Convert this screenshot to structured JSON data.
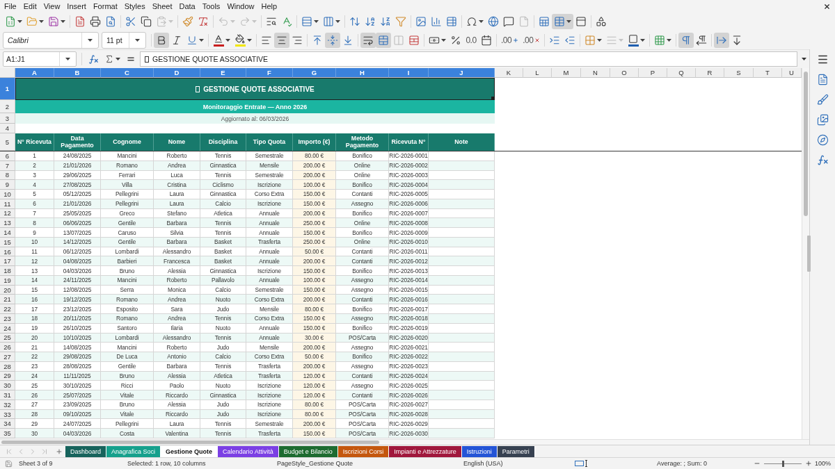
{
  "menu": [
    "File",
    "Edit",
    "View",
    "Insert",
    "Format",
    "Styles",
    "Sheet",
    "Data",
    "Tools",
    "Window",
    "Help"
  ],
  "standard_toolbar": {
    "groups": [
      [
        {
          "kind": "new",
          "on": false,
          "disabled": false
        },
        {
          "kind": "open",
          "on": false,
          "disabled": false
        },
        {
          "kind": "save",
          "on": false,
          "disabled": false
        }
      ],
      [
        {
          "kind": "pdf",
          "on": false,
          "disabled": false
        },
        {
          "kind": "print",
          "on": false,
          "disabled": false
        },
        {
          "kind": "preview",
          "on": false,
          "disabled": false
        }
      ],
      [
        {
          "kind": "cut",
          "on": false,
          "disabled": false
        },
        {
          "kind": "copy",
          "on": false,
          "disabled": false
        },
        {
          "kind": "paste",
          "on": false,
          "disabled": true
        }
      ],
      [
        {
          "kind": "clone",
          "on": false,
          "disabled": false
        },
        {
          "kind": "clear",
          "on": false,
          "disabled": false
        }
      ],
      [
        {
          "kind": "undo",
          "on": false,
          "disabled": true
        },
        {
          "kind": "redo",
          "on": false,
          "disabled": true
        }
      ],
      [
        {
          "kind": "find",
          "on": false,
          "disabled": false
        },
        {
          "kind": "spelling",
          "on": false,
          "disabled": false
        }
      ],
      [
        {
          "kind": "row",
          "on": false,
          "disabled": false
        },
        {
          "kind": "column",
          "on": false,
          "disabled": false
        }
      ],
      [
        {
          "kind": "sort",
          "on": false,
          "disabled": false
        },
        {
          "kind": "sortasc",
          "on": false,
          "disabled": false
        },
        {
          "kind": "sortdesc",
          "on": false,
          "disabled": false
        },
        {
          "kind": "autofilter",
          "on": false,
          "disabled": false
        }
      ],
      [
        {
          "kind": "image",
          "on": false,
          "disabled": false
        },
        {
          "kind": "chart",
          "on": false,
          "disabled": false
        },
        {
          "kind": "pivot",
          "on": false,
          "disabled": false
        }
      ],
      [
        {
          "kind": "special",
          "on": false,
          "disabled": false
        },
        {
          "kind": "hyperlink",
          "on": false,
          "disabled": false
        },
        {
          "kind": "comment",
          "on": false,
          "disabled": false
        },
        {
          "kind": "headerfooter",
          "on": false,
          "disabled": true
        }
      ],
      [
        {
          "kind": "printrange",
          "on": false,
          "disabled": false
        },
        {
          "kind": "freeze",
          "on": true,
          "disabled": false
        },
        {
          "kind": "split",
          "on": false,
          "disabled": false
        }
      ],
      [
        {
          "kind": "shapes",
          "on": false,
          "disabled": false
        }
      ]
    ]
  },
  "formatting_toolbar": {
    "font_name": "Calibri",
    "font_substituted": true,
    "font_size": "11 pt",
    "groups": [
      [
        {
          "kind": "bold",
          "on": true,
          "disabled": false
        },
        {
          "kind": "italic",
          "on": false,
          "disabled": false
        },
        {
          "kind": "underline",
          "on": false,
          "disabled": false
        }
      ],
      [
        {
          "kind": "fontcolor",
          "on": false,
          "disabled": false
        },
        {
          "kind": "highlight",
          "on": false,
          "disabled": false
        }
      ],
      [
        {
          "kind": "alignleft",
          "on": false,
          "disabled": false
        },
        {
          "kind": "aligncenter",
          "on": true,
          "disabled": false
        },
        {
          "kind": "alignright",
          "on": false,
          "disabled": false
        }
      ],
      [
        {
          "kind": "aligntop",
          "on": false,
          "disabled": false
        },
        {
          "kind": "alignmiddle",
          "on": true,
          "disabled": false
        },
        {
          "kind": "alignbottom",
          "on": false,
          "disabled": false
        }
      ],
      [
        {
          "kind": "wrap",
          "on": true,
          "disabled": false
        },
        {
          "kind": "mergecenter",
          "on": true,
          "disabled": false
        },
        {
          "kind": "merge",
          "on": false,
          "disabled": true
        },
        {
          "kind": "unmerge",
          "on": false,
          "disabled": false
        }
      ],
      [
        {
          "kind": "currency",
          "on": false,
          "disabled": false
        },
        {
          "kind": "percent",
          "on": false,
          "disabled": false
        },
        {
          "kind": "number",
          "label": "0.0",
          "on": false,
          "disabled": false
        },
        {
          "kind": "date",
          "on": false,
          "disabled": false
        }
      ],
      [
        {
          "kind": "adddec",
          "label": ".00",
          "on": false,
          "disabled": false
        },
        {
          "kind": "deldec",
          "label": ".00",
          "on": false,
          "disabled": false
        }
      ],
      [
        {
          "kind": "indentmore",
          "on": false,
          "disabled": false
        },
        {
          "kind": "indentless",
          "on": false,
          "disabled": false
        }
      ],
      [
        {
          "kind": "borders",
          "on": false,
          "disabled": false
        },
        {
          "kind": "borderstyle",
          "on": false,
          "disabled": true
        },
        {
          "kind": "bordercolor",
          "on": false,
          "disabled": false
        }
      ],
      [
        {
          "kind": "conditional",
          "on": false,
          "disabled": false
        }
      ],
      [
        {
          "kind": "ltr",
          "on": true,
          "disabled": false
        },
        {
          "kind": "rtl",
          "on": false,
          "disabled": false
        }
      ],
      [
        {
          "kind": "textdir",
          "on": true,
          "disabled": false
        },
        {
          "kind": "vertical",
          "on": false,
          "disabled": false
        }
      ]
    ]
  },
  "formula_bar": {
    "name_box": "A1:J1",
    "formula": "GESTIONE QUOTE ASSOCIATIVE"
  },
  "sheet": {
    "columns": [
      {
        "label": "A",
        "selected": true
      },
      {
        "label": "B",
        "selected": true
      },
      {
        "label": "C",
        "selected": true
      },
      {
        "label": "D",
        "selected": true
      },
      {
        "label": "E",
        "selected": true
      },
      {
        "label": "F",
        "selected": true
      },
      {
        "label": "G",
        "selected": true
      },
      {
        "label": "H",
        "selected": true
      },
      {
        "label": "I",
        "selected": true
      },
      {
        "label": "J",
        "selected": true
      },
      {
        "label": "K",
        "selected": false
      },
      {
        "label": "L",
        "selected": false
      },
      {
        "label": "M",
        "selected": false
      },
      {
        "label": "N",
        "selected": false
      },
      {
        "label": "O",
        "selected": false
      },
      {
        "label": "P",
        "selected": false
      },
      {
        "label": "Q",
        "selected": false
      },
      {
        "label": "R",
        "selected": false
      },
      {
        "label": "S",
        "selected": false
      },
      {
        "label": "T",
        "selected": false
      },
      {
        "label": "U",
        "selected": false
      }
    ],
    "rows": [
      {
        "label": "1",
        "selected": true
      },
      {
        "label": "2",
        "selected": false
      },
      {
        "label": "3",
        "selected": false
      },
      {
        "label": "4",
        "selected": false
      },
      {
        "label": "5",
        "selected": false
      },
      {
        "label": "6",
        "selected": false
      },
      {
        "label": "7",
        "selected": false
      },
      {
        "label": "8",
        "selected": false
      },
      {
        "label": "9",
        "selected": false
      },
      {
        "label": "10",
        "selected": false
      },
      {
        "label": "11",
        "selected": false
      },
      {
        "label": "12",
        "selected": false
      },
      {
        "label": "13",
        "selected": false
      },
      {
        "label": "14",
        "selected": false
      },
      {
        "label": "15",
        "selected": false
      },
      {
        "label": "16",
        "selected": false
      },
      {
        "label": "17",
        "selected": false
      },
      {
        "label": "18",
        "selected": false
      },
      {
        "label": "19",
        "selected": false
      },
      {
        "label": "20",
        "selected": false
      },
      {
        "label": "21",
        "selected": false
      },
      {
        "label": "22",
        "selected": false
      },
      {
        "label": "23",
        "selected": false
      },
      {
        "label": "24",
        "selected": false
      },
      {
        "label": "25",
        "selected": false
      },
      {
        "label": "26",
        "selected": false
      },
      {
        "label": "27",
        "selected": false
      },
      {
        "label": "28",
        "selected": false
      },
      {
        "label": "29",
        "selected": false
      },
      {
        "label": "30",
        "selected": false
      },
      {
        "label": "31",
        "selected": false
      },
      {
        "label": "32",
        "selected": false
      },
      {
        "label": "33",
        "selected": false
      },
      {
        "label": "34",
        "selected": false
      },
      {
        "label": "35",
        "selected": false
      }
    ],
    "title": {
      "text": "GESTIONE QUOTE ASSOCIATIVE",
      "selected": true
    },
    "subtitle": "Monitoraggio Entrate — Anno 2026",
    "updated": "Aggiornato al: 06/03/2026",
    "headers": [
      "N° Ricevuta",
      "Data Pagamento",
      "Cognome",
      "Nome",
      "Disciplina",
      "Tipo Quota",
      "Importo (€)",
      "Metodo Pagamento",
      "Ricevuta N°",
      "Note"
    ],
    "records": [
      [
        "1",
        "24/08/2025",
        "Mancini",
        "Roberto",
        "Tennis",
        "Semestrale",
        "80.00 €",
        "Bonifico",
        "RIC-2026-0001"
      ],
      [
        "2",
        "21/01/2026",
        "Romano",
        "Andrea",
        "Ginnastica",
        "Mensile",
        "200.00 €",
        "Online",
        "RIC-2026-0002"
      ],
      [
        "3",
        "29/06/2025",
        "Ferrari",
        "Luca",
        "Tennis",
        "Semestrale",
        "200.00 €",
        "Online",
        "RIC-2026-0003"
      ],
      [
        "4",
        "27/08/2025",
        "Villa",
        "Cristina",
        "Ciclismo",
        "Iscrizione",
        "100.00 €",
        "Bonifico",
        "RIC-2026-0004"
      ],
      [
        "5",
        "05/12/2025",
        "Pellegrini",
        "Laura",
        "Ginnastica",
        "Corso Extra",
        "150.00 €",
        "Contanti",
        "RIC-2026-0005"
      ],
      [
        "6",
        "21/01/2026",
        "Pellegrini",
        "Laura",
        "Calcio",
        "Iscrizione",
        "150.00 €",
        "Assegno",
        "RIC-2026-0006"
      ],
      [
        "7",
        "25/05/2025",
        "Greco",
        "Stefano",
        "Atletica",
        "Annuale",
        "200.00 €",
        "Bonifico",
        "RIC-2026-0007"
      ],
      [
        "8",
        "06/06/2025",
        "Gentile",
        "Barbara",
        "Tennis",
        "Annuale",
        "250.00 €",
        "Online",
        "RIC-2026-0008"
      ],
      [
        "9",
        "13/07/2025",
        "Caruso",
        "Silvia",
        "Tennis",
        "Annuale",
        "150.00 €",
        "Bonifico",
        "RIC-2026-0009"
      ],
      [
        "10",
        "14/12/2025",
        "Gentile",
        "Barbara",
        "Basket",
        "Trasferta",
        "250.00 €",
        "Online",
        "RIC-2026-0010"
      ],
      [
        "11",
        "06/12/2025",
        "Lombardi",
        "Alessandro",
        "Basket",
        "Annuale",
        "50.00 €",
        "Contanti",
        "RIC-2026-0011"
      ],
      [
        "12",
        "04/08/2025",
        "Barbieri",
        "Francesca",
        "Basket",
        "Annuale",
        "200.00 €",
        "Contanti",
        "RIC-2026-0012"
      ],
      [
        "13",
        "04/03/2026",
        "Bruno",
        "Alessia",
        "Ginnastica",
        "Iscrizione",
        "150.00 €",
        "Bonifico",
        "RIC-2026-0013"
      ],
      [
        "14",
        "24/11/2025",
        "Mancini",
        "Roberto",
        "Pallavolo",
        "Annuale",
        "100.00 €",
        "Assegno",
        "RIC-2026-0014"
      ],
      [
        "15",
        "12/08/2025",
        "Serra",
        "Monica",
        "Calcio",
        "Semestrale",
        "150.00 €",
        "Assegno",
        "RIC-2026-0015"
      ],
      [
        "16",
        "19/12/2025",
        "Romano",
        "Andrea",
        "Nuoto",
        "Corso Extra",
        "200.00 €",
        "Contanti",
        "RIC-2026-0016"
      ],
      [
        "17",
        "23/12/2025",
        "Esposito",
        "Sara",
        "Judo",
        "Mensile",
        "80.00 €",
        "Bonifico",
        "RIC-2026-0017"
      ],
      [
        "18",
        "20/11/2025",
        "Romano",
        "Andrea",
        "Tennis",
        "Corso Extra",
        "150.00 €",
        "Assegno",
        "RIC-2026-0018"
      ],
      [
        "19",
        "26/10/2025",
        "Santoro",
        "Ilaria",
        "Nuoto",
        "Annuale",
        "150.00 €",
        "Bonifico",
        "RIC-2026-0019"
      ],
      [
        "20",
        "10/10/2025",
        "Lombardi",
        "Alessandro",
        "Tennis",
        "Annuale",
        "30.00 €",
        "POS/Carta",
        "RIC-2026-0020"
      ],
      [
        "21",
        "14/08/2025",
        "Mancini",
        "Roberto",
        "Judo",
        "Mensile",
        "200.00 €",
        "Assegno",
        "RIC-2026-0021"
      ],
      [
        "22",
        "29/08/2025",
        "De Luca",
        "Antonio",
        "Calcio",
        "Corso Extra",
        "50.00 €",
        "Bonifico",
        "RIC-2026-0022"
      ],
      [
        "23",
        "28/08/2025",
        "Gentile",
        "Barbara",
        "Tennis",
        "Trasferta",
        "200.00 €",
        "Assegno",
        "RIC-2026-0023"
      ],
      [
        "24",
        "11/11/2025",
        "Bruno",
        "Alessia",
        "Atletica",
        "Trasferta",
        "120.00 €",
        "Contanti",
        "RIC-2026-0024"
      ],
      [
        "25",
        "30/10/2025",
        "Ricci",
        "Paolo",
        "Nuoto",
        "Iscrizione",
        "120.00 €",
        "Assegno",
        "RIC-2026-0025"
      ],
      [
        "26",
        "25/07/2025",
        "Vitale",
        "Riccardo",
        "Ginnastica",
        "Iscrizione",
        "120.00 €",
        "Contanti",
        "RIC-2026-0026"
      ],
      [
        "27",
        "23/09/2025",
        "Bruno",
        "Alessia",
        "Judo",
        "Iscrizione",
        "80.00 €",
        "POS/Carta",
        "RIC-2026-0027"
      ],
      [
        "28",
        "09/10/2025",
        "Vitale",
        "Riccardo",
        "Judo",
        "Iscrizione",
        "80.00 €",
        "POS/Carta",
        "RIC-2026-0028"
      ],
      [
        "29",
        "24/07/2025",
        "Pellegrini",
        "Laura",
        "Tennis",
        "Semestrale",
        "200.00 €",
        "POS/Carta",
        "RIC-2026-0029"
      ],
      [
        "30",
        "04/03/2026",
        "Costa",
        "Valentina",
        "Tennis",
        "Trasferta",
        "150.00 €",
        "POS/Carta",
        "RIC-2026-0030"
      ]
    ]
  },
  "sheet_tabs": [
    {
      "label": "Dashboard",
      "selected": false,
      "color": "#17635c"
    },
    {
      "label": "Anagrafica Soci",
      "selected": false,
      "color": "#16a08c"
    },
    {
      "label": "Gestione Quote",
      "selected": true
    },
    {
      "label": "Calendario Attività",
      "selected": false,
      "color": "#7b3fe4"
    },
    {
      "label": "Budget e Bilancio",
      "selected": false,
      "color": "#1d6b30"
    },
    {
      "label": "Iscrizioni Corsi",
      "selected": false,
      "color": "#c4570e"
    },
    {
      "label": "Impianti e Attrezzature",
      "selected": false,
      "color": "#a0173c"
    },
    {
      "label": "Istruzioni",
      "selected": false,
      "color": "#2454d6"
    },
    {
      "label": "Parametri",
      "selected": false,
      "color": "#374151"
    }
  ],
  "status_bar": {
    "sheet": "Sheet 3 of 9",
    "selection": "Selected: 1 row, 10 columns",
    "page_style": "PageStyle_Gestione Quote",
    "language": "English (USA)",
    "summary": "Average: ; Sum: 0",
    "zoom_slider": {
      "level": 0.5
    },
    "zoom": "100%"
  }
}
